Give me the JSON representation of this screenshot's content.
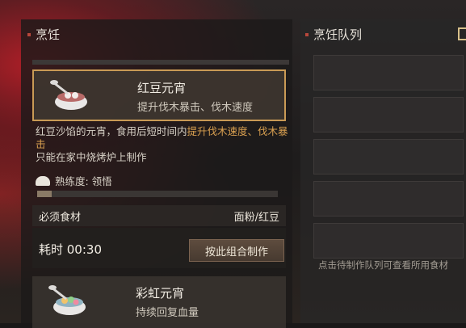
{
  "panels": {
    "cooking_title": "烹饪",
    "queue_title": "烹饪队列"
  },
  "selected_recipe": {
    "name": "红豆元宵",
    "desc": "提升伐木暴击、伐木速度"
  },
  "detail": {
    "desc_prefix": "红豆沙馅的元宵，食用后短时间内",
    "desc_highlight_1": "提升伐木速度、伐木暴击",
    "note": "只能在家中烧烤炉上制作",
    "skill_label": "熟练度: 领悟",
    "skill_progress": 0.06
  },
  "ingredients": {
    "label": "必须食材",
    "items": "面粉/红豆"
  },
  "craft": {
    "time": "耗时 00:30",
    "button": "按此组合制作"
  },
  "next_recipe": {
    "name": "彩虹元宵",
    "desc": "持续回复血量"
  },
  "queue": {
    "hint": "点击待制作队列可查看所用食材"
  },
  "icons": [
    "bowl-red-bean-icon",
    "bowl-rainbow-icon",
    "chef-hat-icon",
    "queue-bracket-icon"
  ],
  "colors": {
    "highlight": "#d9a050",
    "selected_border": "#c99a55",
    "title_dot": "#b7473b"
  }
}
